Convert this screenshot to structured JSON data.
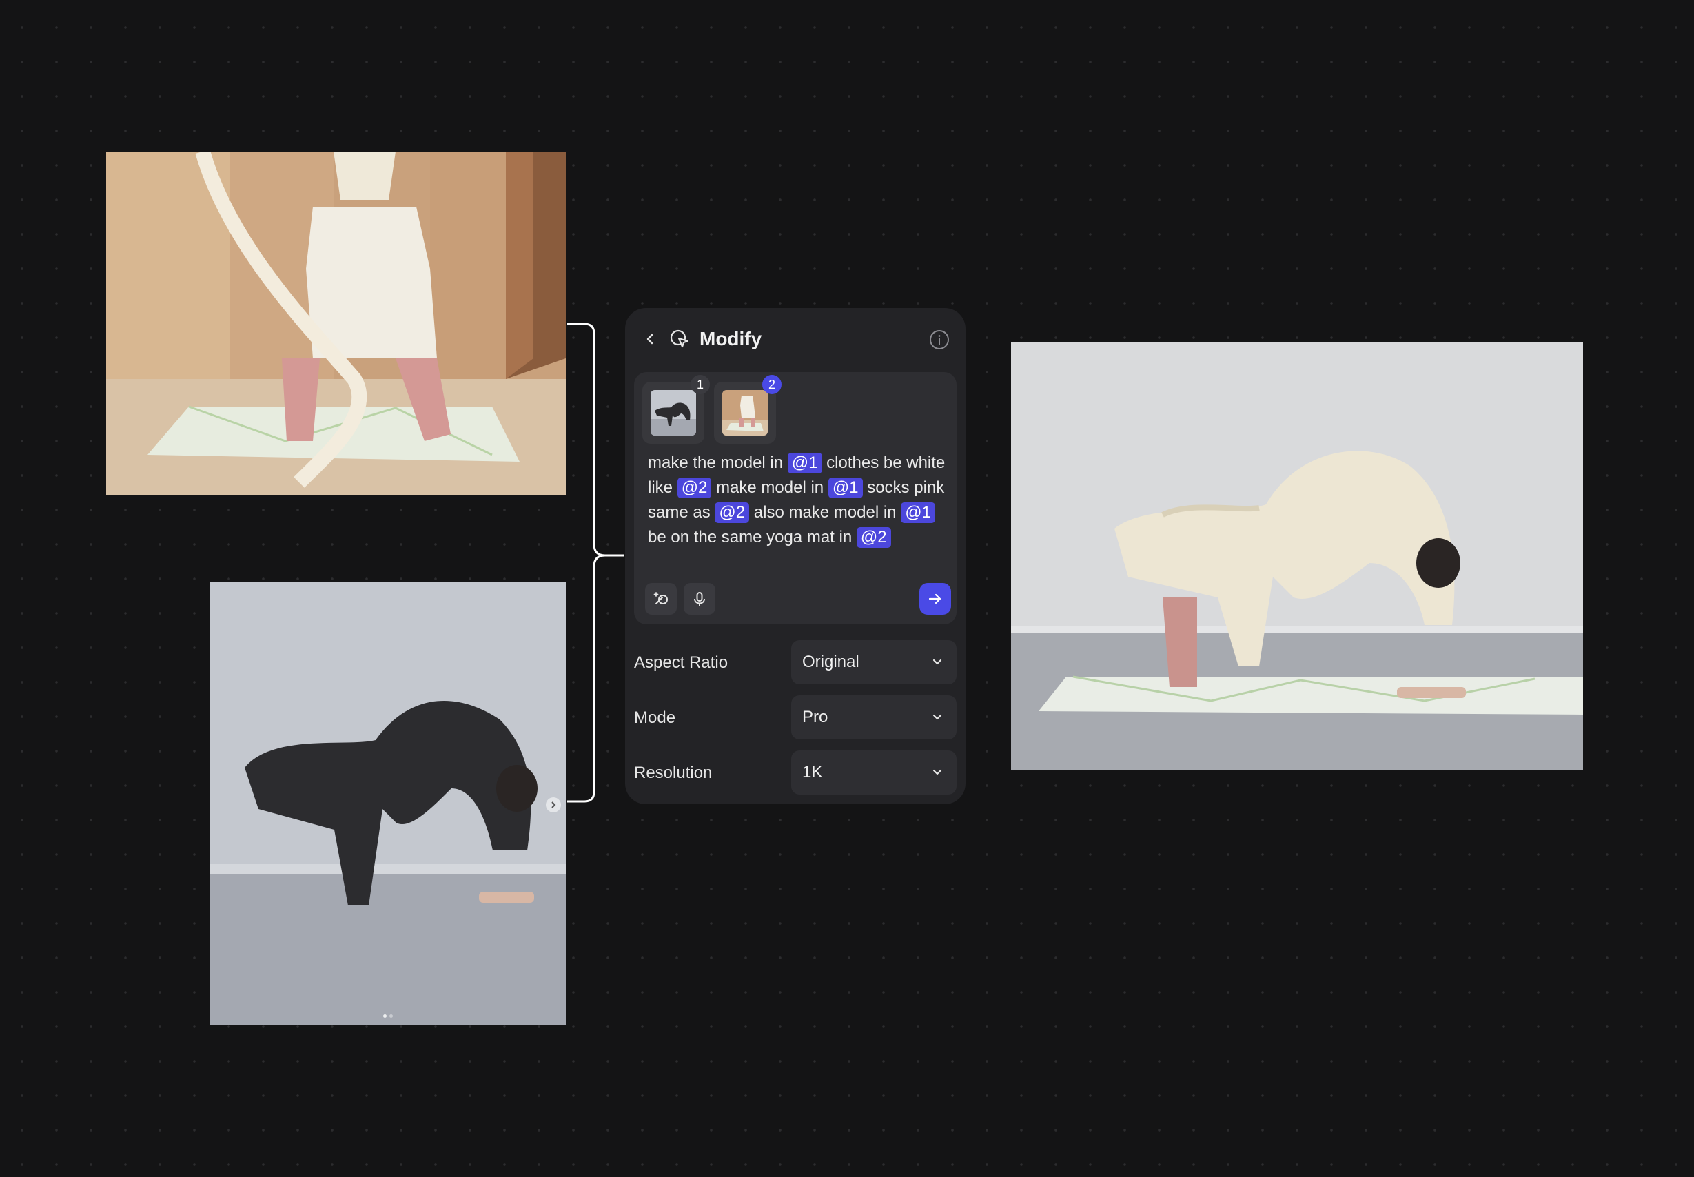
{
  "panel": {
    "title": "Modify",
    "references": [
      {
        "index": "1",
        "description": "model in black clothes bending backwards"
      },
      {
        "index": "2",
        "description": "model in white skirt and pink socks on yoga mat"
      }
    ],
    "prompt": [
      {
        "t": "make the model in "
      },
      {
        "m": "@1"
      },
      {
        "t": " clothes be white like "
      },
      {
        "m": "@2"
      },
      {
        "t": " make model in "
      },
      {
        "m": "@1"
      },
      {
        "t": " socks pink same as "
      },
      {
        "m": "@2"
      },
      {
        "t": " also make model in "
      },
      {
        "m": "@1"
      },
      {
        "t": " be on the same yoga mat in "
      },
      {
        "m": "@2"
      }
    ],
    "settings": [
      {
        "label": "Aspect Ratio",
        "value": "Original"
      },
      {
        "label": "Mode",
        "value": "Pro"
      },
      {
        "label": "Resolution",
        "value": "1K"
      }
    ]
  },
  "colors": {
    "background": "#141415",
    "panel": "#232326",
    "accent": "#4a4ae6",
    "mention": "#4c47dc"
  },
  "icons": {
    "back": "chevron-left-icon",
    "modify": "cursor-sparkle-icon",
    "info": "info-icon",
    "magic": "magic-wand-icon",
    "mic": "microphone-icon",
    "send": "arrow-right-icon",
    "dropdown": "chevron-down-icon"
  }
}
